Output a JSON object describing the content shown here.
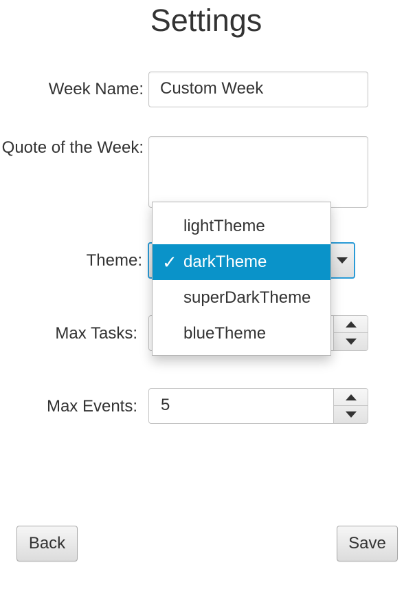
{
  "window": {
    "title": "Settings"
  },
  "form": {
    "week_name_label": "Week Name:",
    "week_name_value": "Custom Week",
    "quote_label": "Quote of the Week:",
    "quote_value": "",
    "theme_label": "Theme:",
    "theme_selected": "darkTheme",
    "max_tasks_label": "Max Tasks:",
    "max_events_label": "Max Events:",
    "max_events_value": "5"
  },
  "theme_dropdown": {
    "options": [
      "lightTheme",
      "darkTheme",
      "superDarkTheme",
      "blueTheme"
    ],
    "selected_index": 1,
    "check_glyph": "✓"
  },
  "buttons": {
    "back_label": "Back",
    "save_label": "Save"
  },
  "colors": {
    "accent": "#0a93c9",
    "focus_border": "#2a9bd7",
    "text": "#333333"
  },
  "icons": {
    "combo_arrow": "chevron-down-icon",
    "spinner_up": "arrow-up-icon",
    "spinner_down": "arrow-down-icon",
    "selected_option": "check-icon"
  }
}
